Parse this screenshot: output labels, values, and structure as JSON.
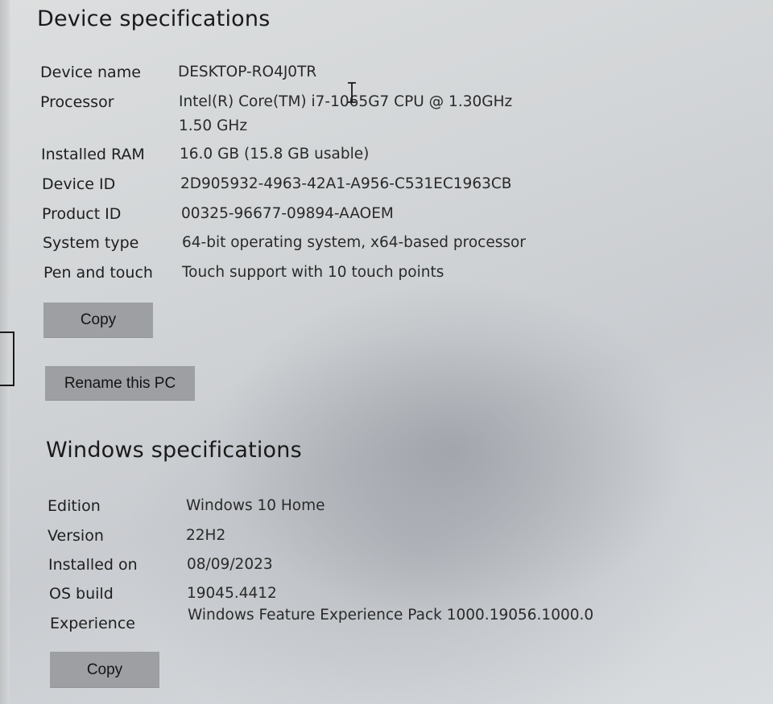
{
  "device_specs": {
    "title": "Device specifications",
    "rows": [
      {
        "label": "Device name",
        "value": "DESKTOP-RO4J0TR"
      },
      {
        "label": "Processor",
        "value": "Intel(R) Core(TM) i7-1065G7 CPU @ 1.30GHz   1.50 GHz"
      },
      {
        "label": "Installed RAM",
        "value": "16.0 GB (15.8 GB usable)"
      },
      {
        "label": "Device ID",
        "value": "2D905932-4963-42A1-A956-C531EC1963CB"
      },
      {
        "label": "Product ID",
        "value": "00325-96677-09894-AAOEM"
      },
      {
        "label": "System type",
        "value": "64-bit operating system, x64-based processor"
      },
      {
        "label": "Pen and touch",
        "value": "Touch support with 10 touch points"
      }
    ],
    "copy_label": "Copy",
    "rename_label": "Rename this PC"
  },
  "windows_specs": {
    "title": "Windows specifications",
    "rows": [
      {
        "label": "Edition",
        "value": "Windows 10 Home"
      },
      {
        "label": "Version",
        "value": "22H2"
      },
      {
        "label": "Installed on",
        "value": "08/09/2023"
      },
      {
        "label": "OS build",
        "value": "19045.4412"
      },
      {
        "label": "Experience",
        "value": "Windows Feature Experience Pack 1000.19056.1000.0"
      }
    ],
    "copy_label": "Copy"
  },
  "icons": {
    "cursor": "text-cursor-icon"
  },
  "colors": {
    "button_bg": "#9d9fa3",
    "text": "#1f1f1f"
  }
}
